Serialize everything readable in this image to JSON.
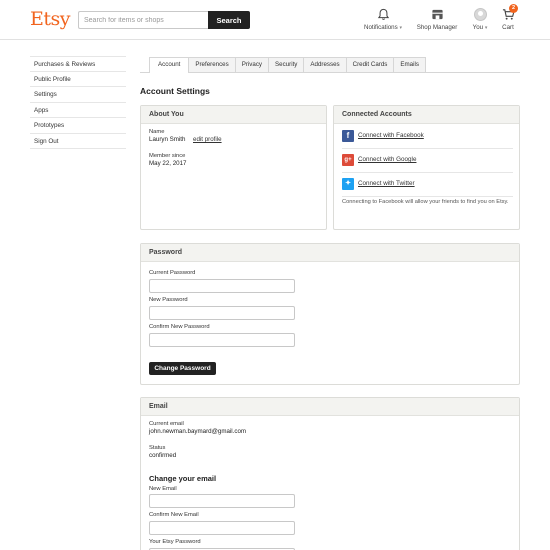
{
  "header": {
    "logo": "Etsy",
    "search_placeholder": "Search for items or shops",
    "search_button": "Search",
    "nav": {
      "notifications": "Notifications",
      "shop_manager": "Shop Manager",
      "you": "You",
      "cart": "Cart",
      "cart_count": "2"
    }
  },
  "sidebar": {
    "items": [
      {
        "label": "Purchases & Reviews"
      },
      {
        "label": "Public Profile"
      },
      {
        "label": "Settings"
      },
      {
        "label": "Apps"
      },
      {
        "label": "Prototypes"
      },
      {
        "label": "Sign Out"
      }
    ]
  },
  "tabs": [
    {
      "label": "Account",
      "active": true
    },
    {
      "label": "Preferences"
    },
    {
      "label": "Privacy"
    },
    {
      "label": "Security"
    },
    {
      "label": "Addresses"
    },
    {
      "label": "Credit Cards"
    },
    {
      "label": "Emails"
    }
  ],
  "page_title": "Account Settings",
  "about": {
    "title": "About You",
    "name_label": "Name",
    "name_value": "Lauryn Smith",
    "edit_link": "edit profile",
    "member_label": "Member since",
    "member_value": "May 22, 2017"
  },
  "connected": {
    "title": "Connected Accounts",
    "facebook": "Connect with Facebook",
    "google": "Connect with Google",
    "twitter": "Connect with Twitter",
    "note": "Connecting to Facebook will allow your friends to find you on Etsy."
  },
  "password": {
    "title": "Password",
    "current_label": "Current Password",
    "new_label": "New Password",
    "confirm_label": "Confirm New Password",
    "button": "Change Password"
  },
  "email": {
    "title": "Email",
    "current_label": "Current email",
    "current_value": "john.newman.baymard@gmail.com",
    "status_label": "Status",
    "status_value": "confirmed",
    "change_heading": "Change your email",
    "new_label": "New Email",
    "confirm_label": "Confirm New Email",
    "password_label": "Your Etsy Password"
  },
  "colors": {
    "brand": "#f1641e",
    "button_dark": "#222222",
    "facebook": "#3b5998",
    "google": "#dd4b39",
    "twitter": "#1da1f2"
  }
}
